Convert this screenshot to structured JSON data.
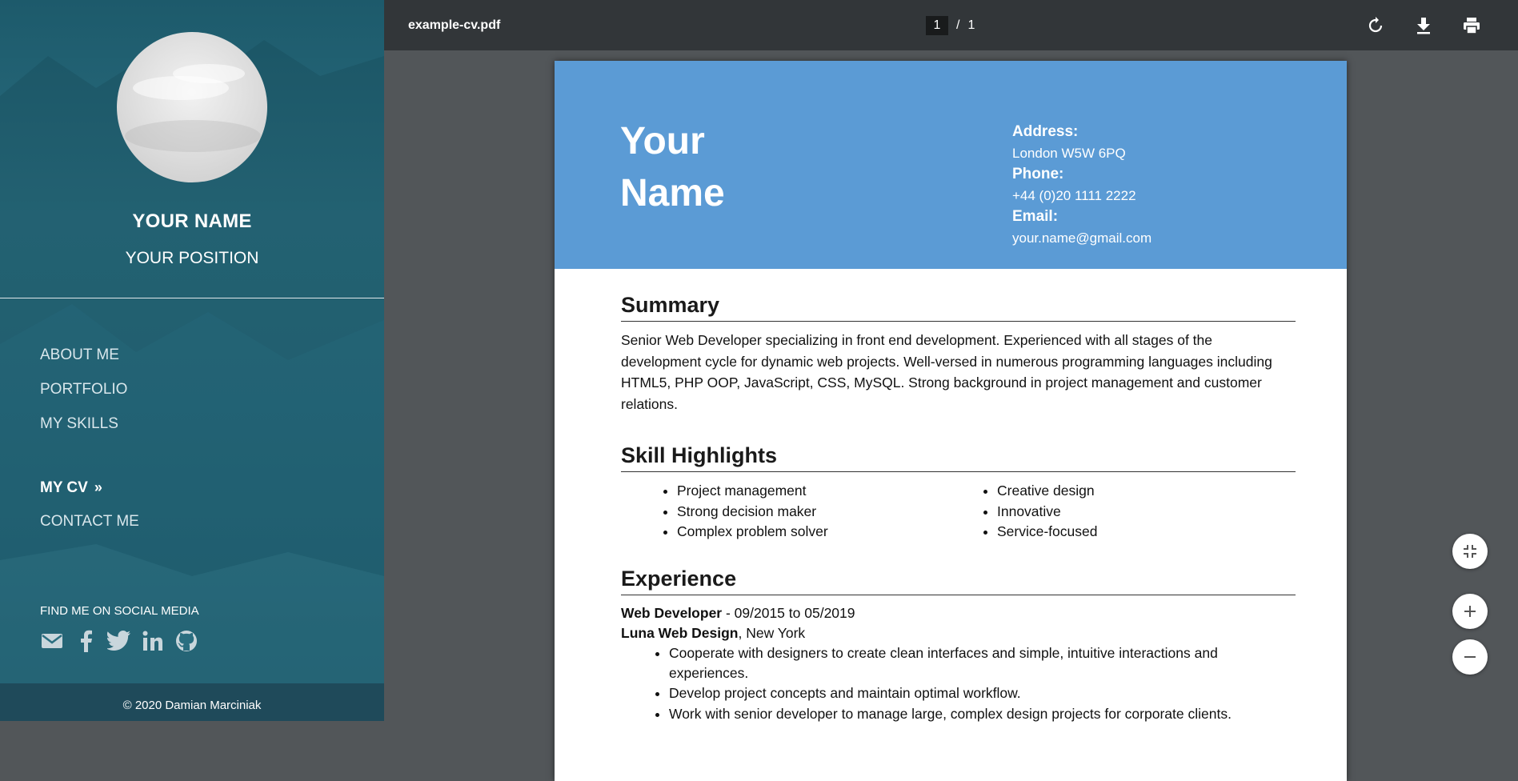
{
  "sidebar": {
    "name": "YOUR NAME",
    "position": "YOUR POSITION",
    "nav": [
      {
        "label": "ABOUT ME"
      },
      {
        "label": "PORTFOLIO"
      },
      {
        "label": "MY SKILLS"
      },
      {
        "label": "MY CV",
        "arrow": "»"
      },
      {
        "label": "CONTACT ME"
      }
    ],
    "social_label": "FIND ME ON SOCIAL MEDIA",
    "social_icons": [
      "mail-icon",
      "facebook-icon",
      "twitter-icon",
      "linkedin-icon",
      "github-icon"
    ],
    "footer": "© 2020 Damian Marciniak"
  },
  "viewer": {
    "file_name": "example-cv.pdf",
    "current_page": "1",
    "separator": "/",
    "total_pages": "1",
    "toolbar_icons": [
      "rotate-icon",
      "download-icon",
      "print-icon"
    ],
    "zoom_icons": [
      "fit-page-icon",
      "zoom-in-icon",
      "zoom-out-icon"
    ]
  },
  "cv": {
    "name_line1": "Your",
    "name_line2": "Name",
    "address_label": "Address:",
    "address": "London W5W 6PQ",
    "phone_label": "Phone:",
    "phone": "+44 (0)20 1111 2222",
    "email_label": "Email:",
    "email": "your.name@gmail.com",
    "summary_title": "Summary",
    "summary_text": "Senior Web Developer specializing in front end development. Experienced with all stages of the development cycle for dynamic web projects. Well-versed in numerous programming languages including HTML5, PHP OOP, JavaScript, CSS, MySQL. Strong background in project management and customer relations.",
    "skills_title": "Skill Highlights",
    "skills_left": [
      "Project management",
      "Strong decision maker",
      "Complex problem solver"
    ],
    "skills_right": [
      "Creative design",
      "Innovative",
      "Service-focused"
    ],
    "experience_title": "Experience",
    "job_title": "Web Developer",
    "job_dates": " - 09/2015 to 05/2019",
    "company": "Luna Web Design",
    "company_location": ", New York",
    "duties": [
      "Cooperate with designers to create clean interfaces and simple, intuitive interactions and experiences.",
      "Develop project concepts and maintain optimal workflow.",
      "Work with senior developer to manage large, complex design projects for corporate clients."
    ]
  },
  "colors": {
    "sidebar_bg": "#27697b",
    "toolbar_bg": "#323639",
    "viewer_bg": "#525659",
    "cv_header_bg": "#5b9bd5"
  }
}
